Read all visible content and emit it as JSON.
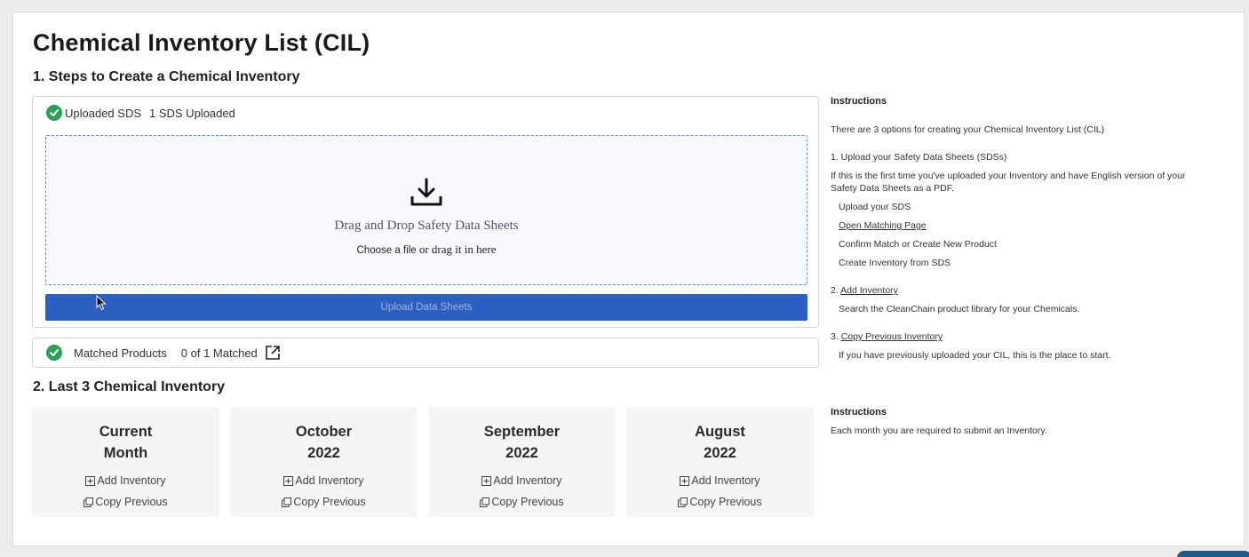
{
  "page_title": "Chemical Inventory List (CIL)",
  "section1": {
    "heading": "1. Steps to Create a Chemical Inventory",
    "uploaded_label": "Uploaded SDS",
    "uploaded_count": "1 SDS Uploaded",
    "dropzone_title": "Drag and Drop Safety Data Sheets",
    "dropzone_choose": "Choose a file",
    "dropzone_or": "or drag it in here",
    "upload_button": "Upload Data Sheets",
    "matched_label": "Matched Products",
    "matched_count": "0 of 1 Matched"
  },
  "section2": {
    "heading": "2. Last 3 Chemical Inventory",
    "cards": [
      {
        "line1": "Current",
        "line2": "Month",
        "add": "Add Inventory",
        "copy": "Copy Previous"
      },
      {
        "line1": "October",
        "line2": "2022",
        "add": "Add Inventory",
        "copy": "Copy Previous"
      },
      {
        "line1": "September",
        "line2": "2022",
        "add": "Add Inventory",
        "copy": "Copy Previous"
      },
      {
        "line1": "August",
        "line2": "2022",
        "add": "Add Inventory",
        "copy": "Copy Previous"
      }
    ]
  },
  "instructions1": {
    "heading": "Instructions",
    "intro": "There are 3 options for creating your Chemical Inventory List (CIL)",
    "opt1_title": "1. Upload your Safety Data Sheets (SDSs)",
    "opt1_desc_a": "If this is the first time you've uploaded your Inventory and have English version of your",
    "opt1_desc_b": "Safety Data Sheets as a PDF.",
    "opt1_step1": "Upload your SDS",
    "opt1_step2": "Open Matching Page",
    "opt1_step3": "Confirm Match or Create New Product",
    "opt1_step4": "Create Inventory from SDS",
    "opt2_num": "2.",
    "opt2_link": "Add Inventory",
    "opt2_desc": "Search the CleanChain product library for your Chemicals.",
    "opt3_num": "3.",
    "opt3_link": "Copy Previous Inventory",
    "opt3_desc": "If you have previously uploaded your CIL, this is the place to start."
  },
  "instructions2": {
    "heading": "Instructions",
    "text": "Each month you are required to submit an Inventory."
  },
  "colors": {
    "primary_button": "#2b5fc2",
    "success": "#2e9e5b",
    "dropzone_border": "#5d8fc9"
  },
  "icons": [
    "check-circle-icon",
    "download-icon",
    "external-link-icon",
    "plus-square-icon",
    "copy-icon"
  ]
}
